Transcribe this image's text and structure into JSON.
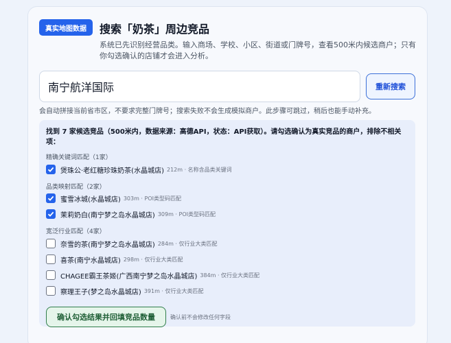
{
  "header": {
    "badge": "真实地图数据",
    "title": "搜索「奶茶」周边竞品",
    "description": "系统已先识别经营品类。输入商场、学校、小区、街道或门牌号，查看500米内候选商户；只有你勾选确认的店铺才会进入分析。"
  },
  "search": {
    "value": "南宁航洋国际",
    "button_label": "重新搜索",
    "hint": "会自动拼接当前省市区，不要求完整门牌号；搜索失败不会生成模拟商户。此步骤可跳过，稍后也能手动补充。"
  },
  "results": {
    "summary": "找到 7 家候选竞品（500米内，数据来源：高德API，状态：API获取）。请勾选确认为真实竞品的商户，排除不相关项：",
    "groups": [
      {
        "label": "精确关键词匹配（1家）",
        "items": [
          {
            "name": "煲珠公·老红糖珍珠奶茶(水晶城店)",
            "meta": "212m · 名称含品类关键词",
            "checked": true
          }
        ]
      },
      {
        "label": "品类映射匹配（2家）",
        "items": [
          {
            "name": "蜜雪冰城(水晶城店)",
            "meta": "303m · POI类型码匹配",
            "checked": true
          },
          {
            "name": "茉莉奶白(南宁梦之岛水晶城店)",
            "meta": "309m · POI类型码匹配",
            "checked": true
          }
        ]
      },
      {
        "label": "宽泛行业匹配（4家）",
        "items": [
          {
            "name": "奈雪的茶(南宁梦之岛水晶城店)",
            "meta": "284m · 仅行业大类匹配",
            "checked": false
          },
          {
            "name": "喜茶(南宁水晶城店)",
            "meta": "298m · 仅行业大类匹配",
            "checked": false
          },
          {
            "name": "CHAGEE霸王茶姬(广西南宁梦之岛水晶城店)",
            "meta": "384m · 仅行业大类匹配",
            "checked": false
          },
          {
            "name": "察理王子(梦之岛水晶城店)",
            "meta": "391m · 仅行业大类匹配",
            "checked": false
          }
        ]
      }
    ],
    "confirm_label": "确认勾选结果并回填竞品数量",
    "confirm_note": "确认前不会修改任何字段"
  },
  "icons": {
    "check": "check-icon"
  },
  "colors": {
    "accent": "#2563eb",
    "confirm": "#2f7d4a"
  }
}
